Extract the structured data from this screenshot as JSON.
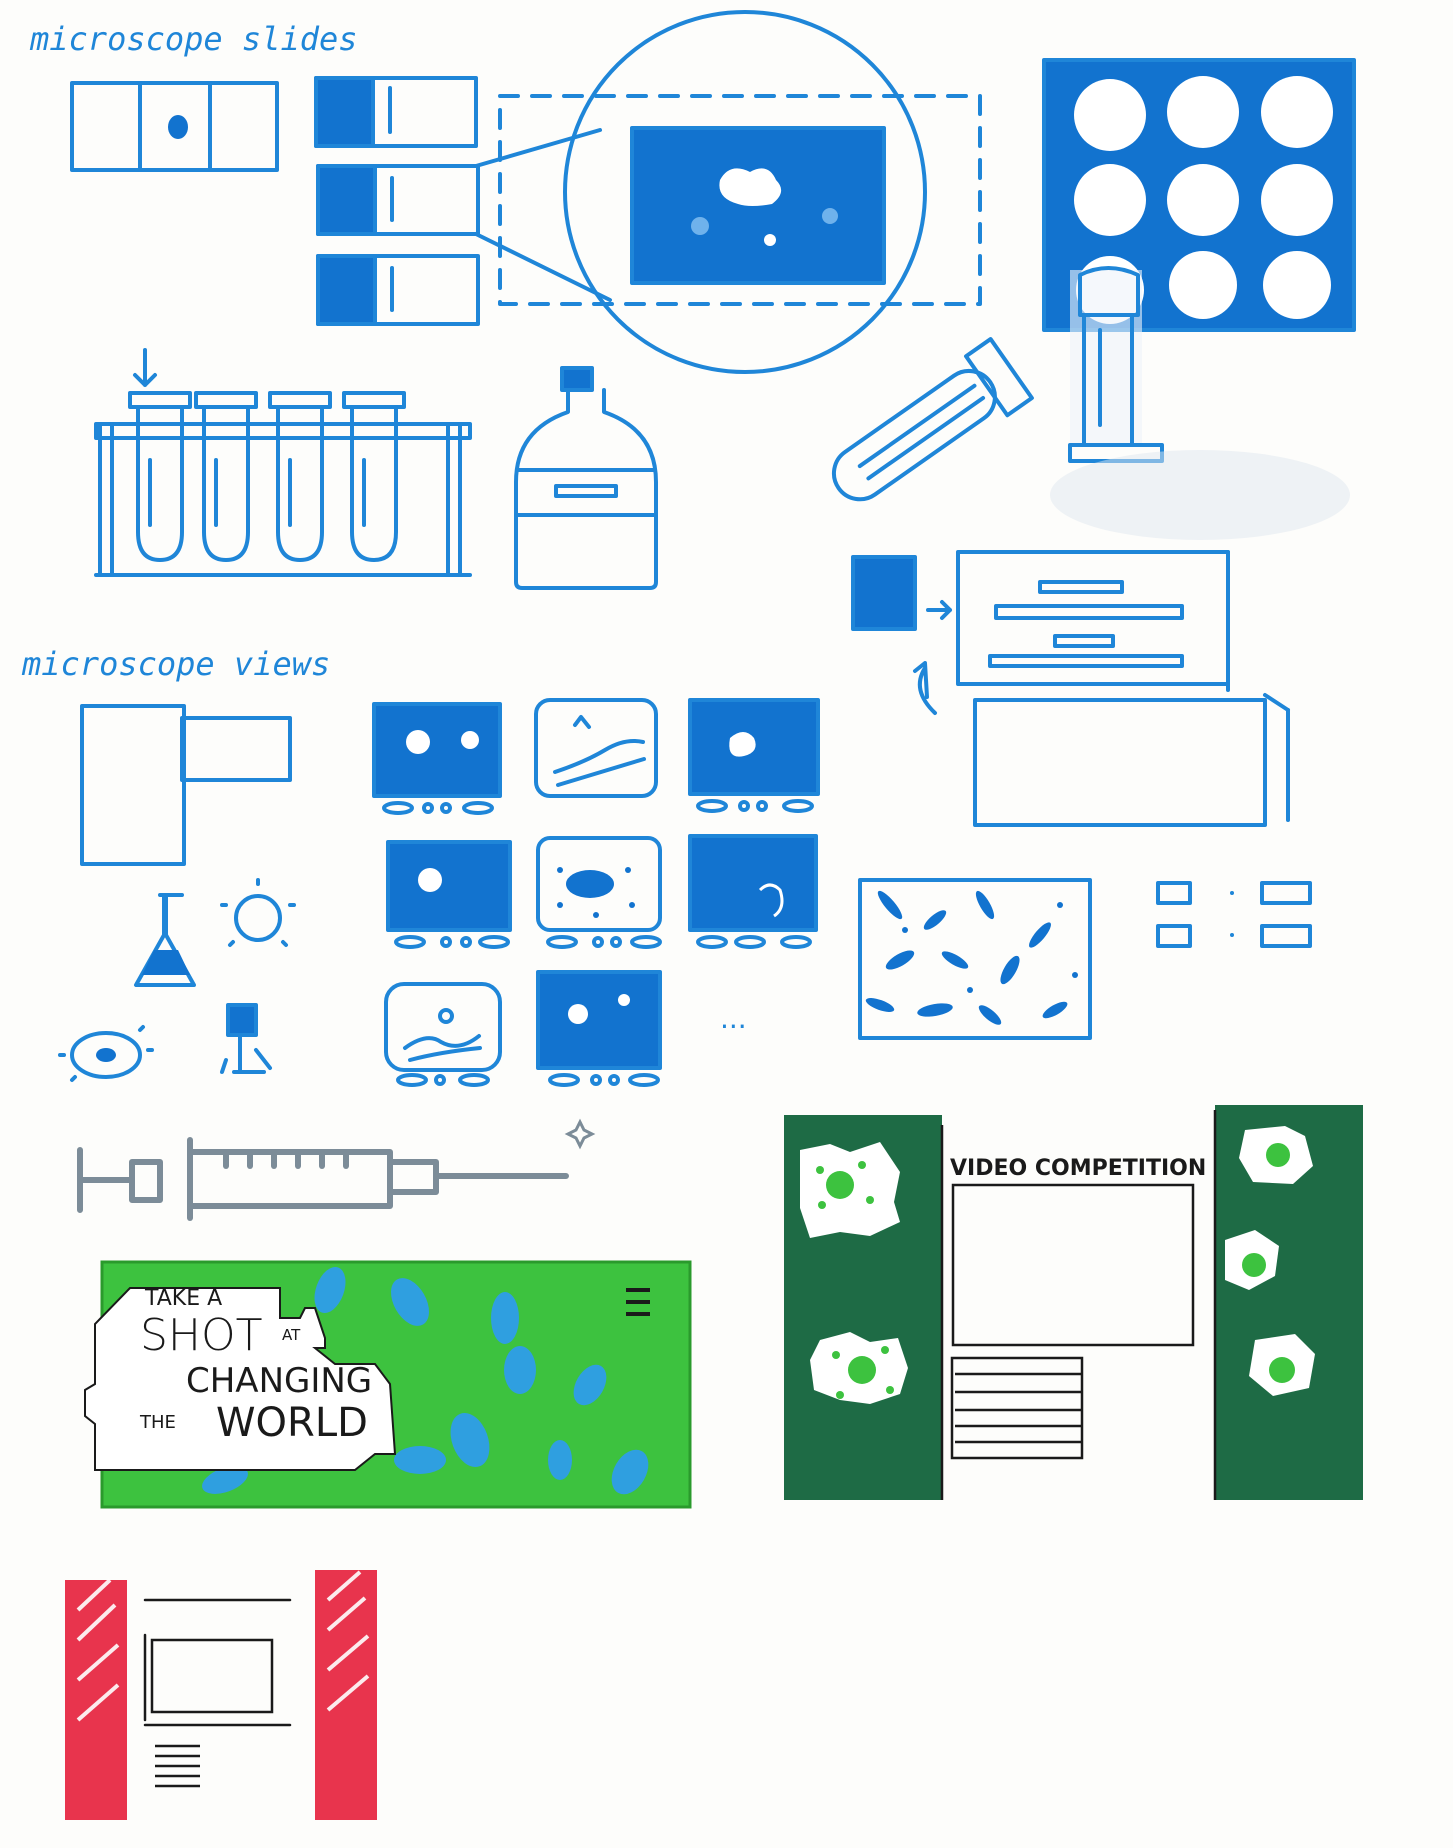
{
  "labels": {
    "slides_heading": "microscope slides",
    "views_heading": "microscope views"
  },
  "green_banner": {
    "line1": "TAKE A",
    "line2a": "SHOT",
    "line2b": "AT",
    "line3": "CHANGING",
    "line4a": "THE",
    "line4b": "WORLD"
  },
  "dark_green_panel": {
    "title": "VIDEO COMPETITION"
  },
  "ellipsis": "...",
  "colors": {
    "blue_ink": "#1f86d8",
    "blue_fill": "#1273cf",
    "bright_green": "#3dc23f",
    "dark_green": "#1e6b45",
    "red": "#e8344d",
    "grey_marker": "#7c8c98"
  }
}
